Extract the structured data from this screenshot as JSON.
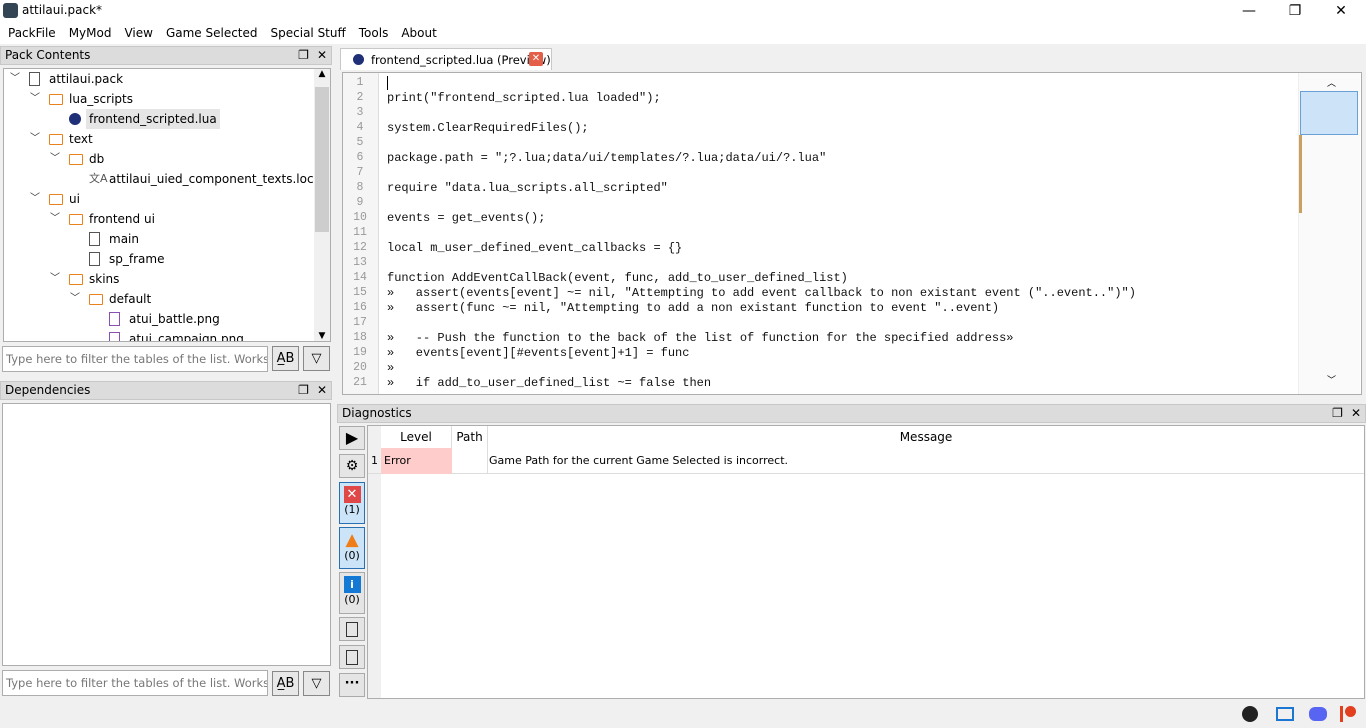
{
  "window": {
    "title": "attilaui.pack*",
    "minimize": "—",
    "maximize": "❐",
    "close": "✕"
  },
  "menu": [
    "PackFile",
    "MyMod",
    "View",
    "Game Selected",
    "Special Stuff",
    "Tools",
    "About"
  ],
  "pack_contents": {
    "title": "Pack Contents",
    "tree": [
      {
        "label": "attilaui.pack",
        "depth": 0,
        "type": "pack",
        "expanded": true
      },
      {
        "label": "lua_scripts",
        "depth": 1,
        "type": "folder",
        "expanded": true
      },
      {
        "label": "frontend_scripted.lua",
        "depth": 2,
        "type": "lua",
        "selected": true
      },
      {
        "label": "text",
        "depth": 1,
        "type": "folder",
        "expanded": true
      },
      {
        "label": "db",
        "depth": 2,
        "type": "folder",
        "expanded": true
      },
      {
        "label": "attilaui_uied_component_texts.loc",
        "depth": 3,
        "type": "loc"
      },
      {
        "label": "ui",
        "depth": 1,
        "type": "folder",
        "expanded": true
      },
      {
        "label": "frontend ui",
        "depth": 2,
        "type": "folder",
        "expanded": true
      },
      {
        "label": "main",
        "depth": 3,
        "type": "file"
      },
      {
        "label": "sp_frame",
        "depth": 3,
        "type": "file"
      },
      {
        "label": "skins",
        "depth": 2,
        "type": "folder",
        "expanded": true
      },
      {
        "label": "default",
        "depth": 3,
        "type": "folder",
        "expanded": true
      },
      {
        "label": "atui_battle.png",
        "depth": 4,
        "type": "image"
      },
      {
        "label": "atui_campaign.png",
        "depth": 4,
        "type": "image"
      }
    ],
    "filter_placeholder": "Type here to filter the tables of the list. Works with ..."
  },
  "dependencies": {
    "title": "Dependencies",
    "filter_placeholder": "Type here to filter the tables of the list. Works with ..."
  },
  "editor": {
    "tab_label": "frontend_scripted.lua (Preview)",
    "lines": [
      "",
      "print(\"frontend_scripted.lua loaded\");",
      "",
      "system.ClearRequiredFiles();",
      "",
      "package.path = \";?.lua;data/ui/templates/?.lua;data/ui/?.lua\"",
      "",
      "require \"data.lua_scripts.all_scripted\"",
      "",
      "events = get_events();",
      "",
      "local m_user_defined_event_callbacks = {}",
      "",
      "function AddEventCallBack(event, func, add_to_user_defined_list)",
      "»   assert(events[event] ~= nil, \"Attempting to add event callback to non existant event (\"..event..\")\")",
      "»   assert(func ~= nil, \"Attempting to add a non existant function to event \"..event)",
      "",
      "»   -- Push the function to the back of the list of function for the specified address»",
      "»   events[event][#events[event]+1] = func",
      "»",
      "»   if add_to_user_defined_list ~= false then"
    ]
  },
  "diagnostics": {
    "title": "Diagnostics",
    "columns": [
      "Level",
      "Path",
      "Message"
    ],
    "rows": [
      {
        "index": "1",
        "level": "Error",
        "path": "",
        "message": "Game Path for the current Game Selected is incorrect."
      }
    ],
    "error_count": "(1)",
    "warning_count": "(0)",
    "info_count": "(0)"
  },
  "colors": {
    "error_bg": "#ffcccc",
    "accent": "#e8821e",
    "selected": "#e5e5e5"
  }
}
